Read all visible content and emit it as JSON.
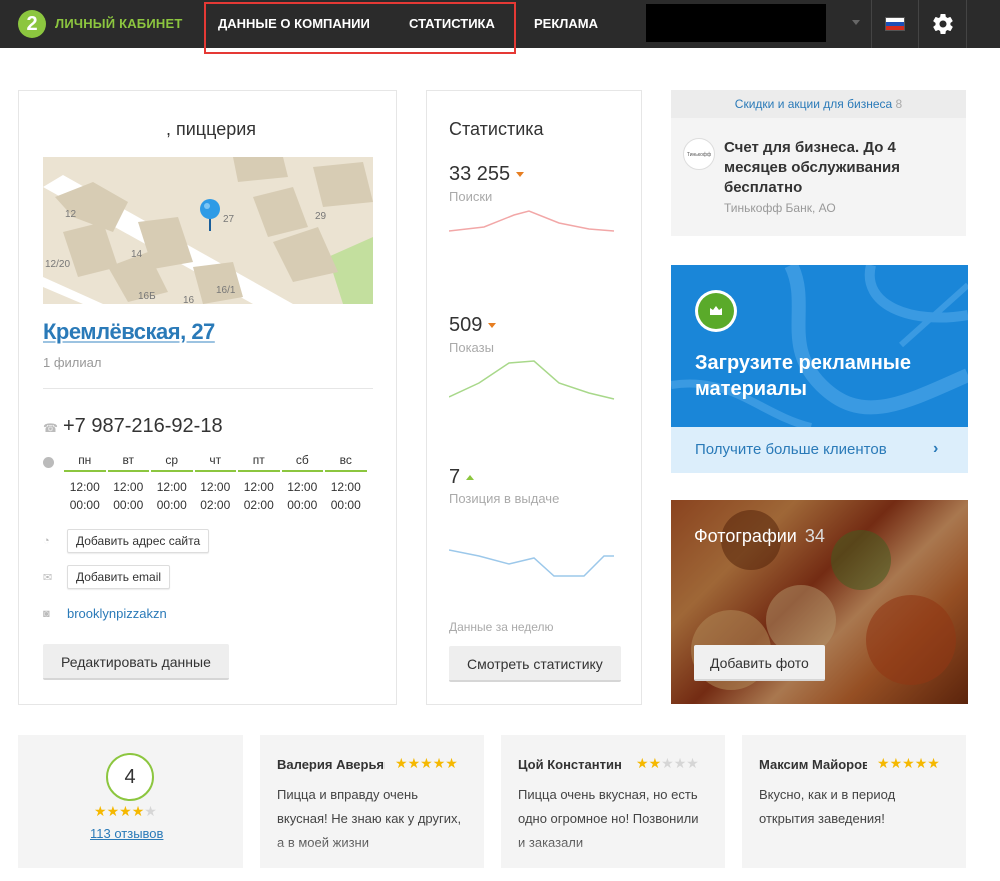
{
  "topbar": {
    "logo_digit": "2",
    "logo_text": "ЛИЧНЫЙ КАБИНЕТ",
    "nav": [
      "ДАННЫЕ О КОМПАНИИ",
      "СТАТИСТИКА",
      "РЕКЛАМА"
    ],
    "flag_colors": [
      "#ffffff",
      "#1c4fb8",
      "#d52b1e"
    ]
  },
  "company": {
    "title": " , пиццерия",
    "address": "Кремлёвская, 27",
    "branches": "1 филиал",
    "phone": "+7 987-216-92-18",
    "map_labels": [
      "12",
      "27",
      "29",
      "12/20",
      "14",
      "16Б",
      "16",
      "16/1"
    ],
    "hours": [
      {
        "day": "пн",
        "open": "12:00",
        "close": "00:00"
      },
      {
        "day": "вт",
        "open": "12:00",
        "close": "00:00"
      },
      {
        "day": "ср",
        "open": "12:00",
        "close": "00:00"
      },
      {
        "day": "чт",
        "open": "12:00",
        "close": "02:00"
      },
      {
        "day": "пт",
        "open": "12:00",
        "close": "02:00"
      },
      {
        "day": "сб",
        "open": "12:00",
        "close": "00:00"
      },
      {
        "day": "вс",
        "open": "12:00",
        "close": "00:00"
      }
    ],
    "add_site_label": "Добавить адрес сайта",
    "add_email_label": "Добавить email",
    "instagram": "brooklynpizzakzn",
    "edit_label": "Редактировать данные"
  },
  "stats": {
    "title": "Статистика",
    "items": [
      {
        "value": "33 255",
        "label": "Поиски",
        "trend": "down",
        "color": "#f2a7a7"
      },
      {
        "value": "509",
        "label": "Показы",
        "trend": "down",
        "color": "#a8d88a"
      },
      {
        "value": "7",
        "label": "Позиция в выдаче",
        "trend": "up",
        "color": "#9cc8ea"
      }
    ],
    "week_note": "Данные за неделю",
    "button_label": "Смотреть статистику"
  },
  "promo": {
    "header": "Скидки и акции для бизнеса",
    "header_count": "8",
    "logo_text": "Тинькофф",
    "title": "Счет для бизнеса. До 4 месяцев обслуживания бесплатно",
    "company": "Тинькофф Банк, АО"
  },
  "upload": {
    "title": "Загрузите рекламные материалы",
    "link": "Получите больше клиентов",
    "chevron": "›"
  },
  "photos": {
    "title": "Фотографии",
    "count": "34",
    "button_label": "Добавить фото"
  },
  "rating": {
    "score": "4",
    "stars": 4,
    "reviews_link": "113 отзывов"
  },
  "reviews": [
    {
      "name": "Валерия Аверьянова",
      "stars": 5,
      "text": "Пицца и вправду очень вкусная! Не знаю как у других, а в моей жизни"
    },
    {
      "name": "Цой Константин",
      "stars": 2,
      "text": "Пицца очень вкусная, но есть одно огромное но! Позвонили и заказали"
    },
    {
      "name": "Максим Майоров",
      "stars": 5,
      "text": "Вкусно, как и в период открытия заведения!"
    }
  ]
}
